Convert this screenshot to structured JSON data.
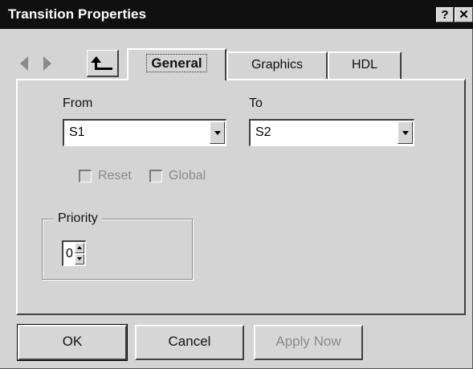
{
  "window": {
    "title": "Transition Properties",
    "help_label": "?",
    "close_label": "✕"
  },
  "tabs": [
    {
      "label": "General",
      "active": true
    },
    {
      "label": "Graphics",
      "active": false
    },
    {
      "label": "HDL",
      "active": false
    }
  ],
  "general": {
    "from_label": "From",
    "from_value": "S1",
    "to_label": "To",
    "to_value": "S2",
    "reset_label": "Reset",
    "global_label": "Global",
    "priority_label": "Priority",
    "priority_value": "0"
  },
  "buttons": {
    "ok": "OK",
    "cancel": "Cancel",
    "apply": "Apply Now"
  },
  "colors": {
    "titlebar": "#101010",
    "dialog": "#d4d4d4",
    "disabled_text": "#8a8a8a"
  },
  "icons": {
    "back": "left-arrow-icon",
    "forward": "right-arrow-icon",
    "up": "return-arrow-icon"
  }
}
